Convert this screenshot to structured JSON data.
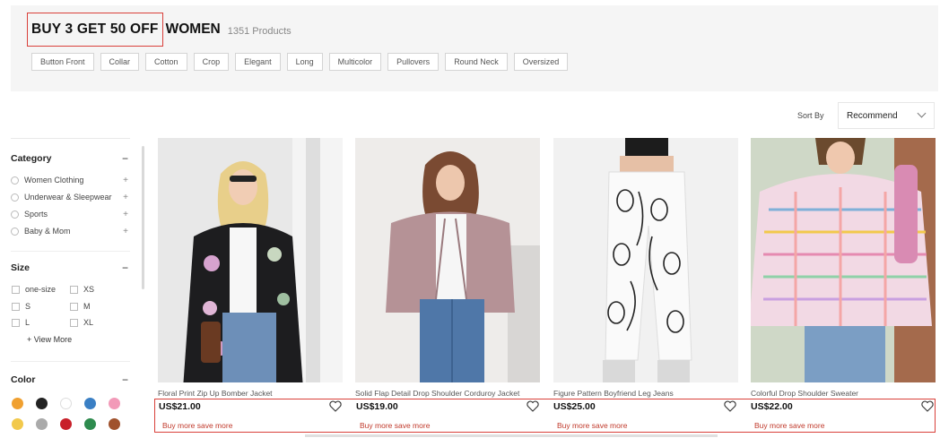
{
  "header": {
    "promo": "BUY 3 GET 50 OFF",
    "category": "WOMEN",
    "count": "1351 Products"
  },
  "tags": [
    "Button Front",
    "Collar",
    "Cotton",
    "Crop",
    "Elegant",
    "Long",
    "Multicolor",
    "Pullovers",
    "Round Neck",
    "Oversized"
  ],
  "sort": {
    "label": "Sort By",
    "value": "Recommend"
  },
  "sidebar": {
    "category": {
      "title": "Category",
      "items": [
        "Women Clothing",
        "Underwear & Sleepwear",
        "Sports",
        "Baby & Mom"
      ]
    },
    "size": {
      "title": "Size",
      "items": [
        "one-size",
        "XS",
        "S",
        "M",
        "L",
        "XL"
      ],
      "view_more": "+ View More"
    },
    "color": {
      "title": "Color",
      "swatches": [
        "#f0a030",
        "#222222",
        "#ffffff",
        "#3a7fc4",
        "#f29ab8",
        "#f2c94c",
        "#aaaaaa",
        "#c8202a",
        "#2e8b4e",
        "#a0522d"
      ]
    }
  },
  "products": [
    {
      "name": "Floral Print Zip Up Bomber Jacket",
      "price": "US$21.00",
      "promo": "Buy more save more",
      "bg": "#e9e9e9"
    },
    {
      "name": "Solid Flap Detail Drop Shoulder Corduroy Jacket",
      "price": "US$19.00",
      "promo": "Buy more save more",
      "bg": "#eeecea"
    },
    {
      "name": "Figure Pattern Boyfriend Leg Jeans",
      "price": "US$25.00",
      "promo": "Buy more save more",
      "bg": "#f1f1f1"
    },
    {
      "name": "Colorful Drop Shoulder Sweater",
      "price": "US$22.00",
      "promo": "Buy more save more",
      "bg": "#cfd8c7"
    }
  ]
}
